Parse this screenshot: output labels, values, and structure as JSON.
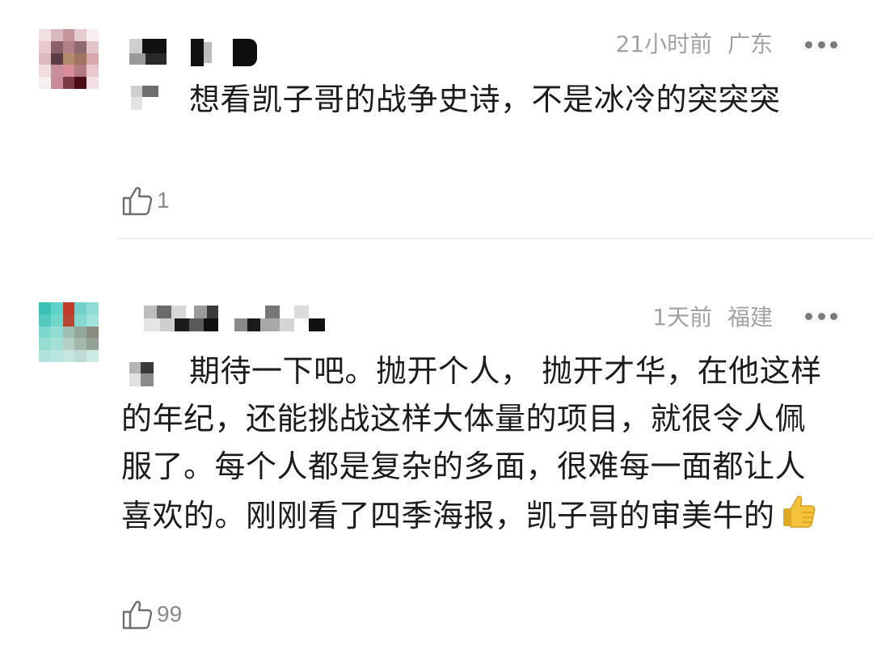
{
  "comments": [
    {
      "time": "21小时前",
      "location": "广东",
      "text": "想看凯子哥的战争史诗，不是冰冷的突突突",
      "likes": "1",
      "like_icon": "thumbs-up-outline-icon",
      "more_icon": "more-dots-icon"
    },
    {
      "time": "1天前",
      "location": "福建",
      "text": "期待一下吧。抛开个人， 抛开才华，在他这样的年纪，还能挑战这样大体量的项目，就很令人佩服了。每个人都是复杂的多面，很难每一面都让人喜欢的。刚刚看了四季海报，凯子哥的审美牛的",
      "emoji": "thumbs-up-emoji",
      "likes": "99",
      "like_icon": "thumbs-up-outline-icon",
      "more_icon": "more-dots-icon"
    }
  ],
  "colors": {
    "meta_text": "#a2a2a2",
    "body_text": "#1c1c1c",
    "divider": "#ececec",
    "emoji_yellow": "#f5c33b"
  }
}
